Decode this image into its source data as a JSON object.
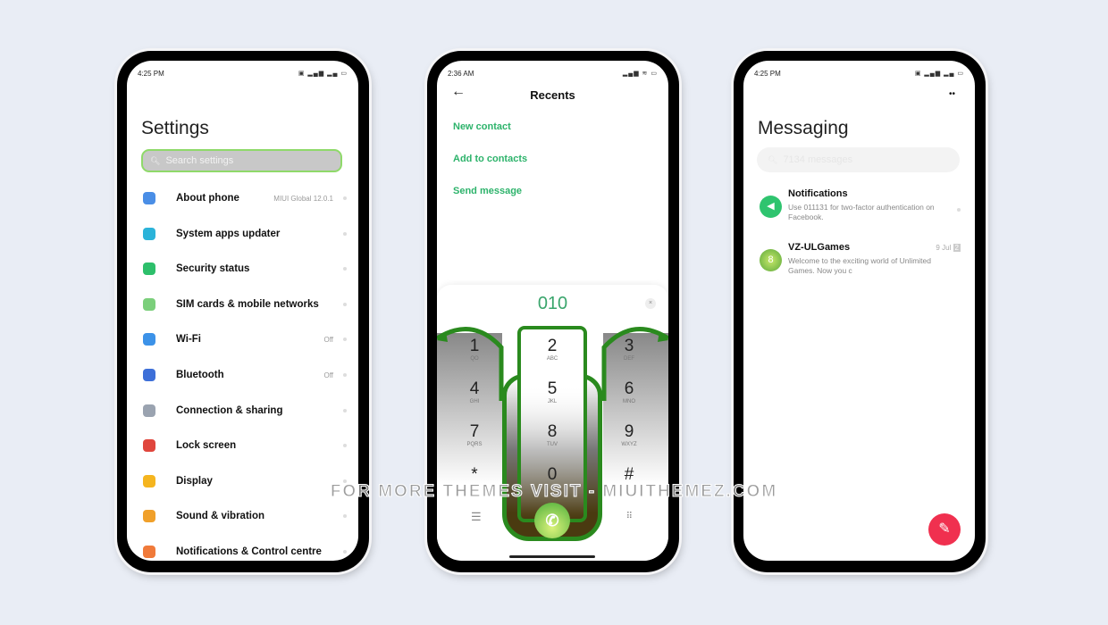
{
  "settings": {
    "time": "4:25 PM",
    "title": "Settings",
    "search_placeholder": "Search settings",
    "items": [
      {
        "label": "About phone",
        "value": "MIUI Global 12.0.1",
        "icon": "phone-icon",
        "color": "#4a8ee6"
      },
      {
        "label": "System apps updater",
        "value": "",
        "icon": "update-arrows-icon",
        "color": "#2bb3d9"
      },
      {
        "label": "Security status",
        "value": "",
        "icon": "shield-icon",
        "color": "#2dbf6b"
      },
      {
        "label": "SIM cards & mobile networks",
        "value": "",
        "icon": "sim-icon",
        "color": "#7bcf7b"
      },
      {
        "label": "Wi-Fi",
        "value": "Off",
        "icon": "wifi-icon",
        "color": "#3c92e8"
      },
      {
        "label": "Bluetooth",
        "value": "Off",
        "icon": "bluetooth-icon",
        "color": "#3d6fd8"
      },
      {
        "label": "Connection & sharing",
        "value": "",
        "icon": "connection-icon",
        "color": "#9aa3b0"
      },
      {
        "label": "Lock screen",
        "value": "",
        "icon": "lock-icon",
        "color": "#e0463d"
      },
      {
        "label": "Display",
        "value": "",
        "icon": "sun-icon",
        "color": "#f5b51f"
      },
      {
        "label": "Sound & vibration",
        "value": "",
        "icon": "bell-icon",
        "color": "#f0a02a"
      },
      {
        "label": "Notifications & Control centre",
        "value": "",
        "icon": "notification-icon",
        "color": "#f07a3a"
      }
    ]
  },
  "dialer": {
    "time": "2:36 AM",
    "title": "Recents",
    "actions": [
      "New contact",
      "Add to contacts",
      "Send message"
    ],
    "number": "010",
    "keys": [
      {
        "n": "1",
        "l": "QO"
      },
      {
        "n": "2",
        "l": "ABC"
      },
      {
        "n": "3",
        "l": "DEF"
      },
      {
        "n": "4",
        "l": "GHI"
      },
      {
        "n": "5",
        "l": "JKL"
      },
      {
        "n": "6",
        "l": "MNO"
      },
      {
        "n": "7",
        "l": "PQRS"
      },
      {
        "n": "8",
        "l": "TUV"
      },
      {
        "n": "9",
        "l": "WXYZ"
      },
      {
        "n": "*",
        "l": ""
      },
      {
        "n": "0",
        "l": ""
      },
      {
        "n": "#",
        "l": ""
      }
    ],
    "accent": "#2a8a1e"
  },
  "messaging": {
    "time": "4:25 PM",
    "title": "Messaging",
    "search_placeholder": "7134 messages",
    "threads": [
      {
        "name": "Notifications",
        "preview": "Use 011131 for two-factor authentication on Facebook.",
        "date": ""
      },
      {
        "name": "VZ-ULGames",
        "preview": "Welcome to the exciting world of Unlimited Games. Now you c",
        "date": "9 Jul",
        "badge": "2"
      }
    ],
    "fab_color": "#f0304f"
  },
  "watermark": "FOR MORE THEMES VISIT - MIUITHEMEZ.COM"
}
